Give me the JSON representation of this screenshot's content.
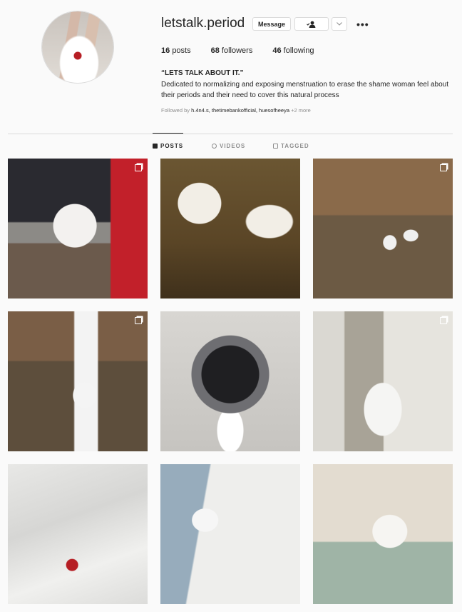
{
  "profile": {
    "username": "letstalk.period",
    "message_label": "Message",
    "follow_icon": "person-check-icon",
    "chevron_icon": "chevron-down-icon",
    "more_icon": "ellipsis-icon",
    "more_text": "•••"
  },
  "stats": {
    "posts_count": "16",
    "posts_label": "posts",
    "followers_count": "68",
    "followers_label": "followers",
    "following_count": "46",
    "following_label": "following"
  },
  "bio": {
    "title": "“LETS TALK ABOUT IT.”",
    "text": "Dedicated to normalizing and exposing menstruation to erase the shame woman feel about their periods and their need to cover this natural process",
    "followed_prefix": "Followed by",
    "followed_names": "h.4n4.s, thetimebankofficial, huesofheeya",
    "followed_more": "+2 more"
  },
  "tabs": [
    {
      "label": "POSTS",
      "icon": "grid-icon",
      "active": true
    },
    {
      "label": "VIDEOS",
      "icon": "play-circle-icon",
      "active": false
    },
    {
      "label": "TAGGED",
      "icon": "tag-icon",
      "active": false
    }
  ],
  "posts": [
    {
      "subject": "dress form with white garment in studio",
      "multi": true
    },
    {
      "subject": "underwear and dress on clothesline",
      "multi": false
    },
    {
      "subject": "people hanging clothes in park",
      "multi": true
    },
    {
      "subject": "stained white dress on clothesline",
      "multi": true
    },
    {
      "subject": "washing machine with stained cloth",
      "multi": false
    },
    {
      "subject": "person in white shorts by door",
      "multi": true
    },
    {
      "subject": "stained white bedsheet",
      "multi": false
    },
    {
      "subject": "folded jeans with underwear",
      "multi": false
    },
    {
      "subject": "person bending in bathroom",
      "multi": false
    }
  ],
  "colors": {
    "background": "#fafafa",
    "text": "#262626",
    "muted": "#8e8e8e",
    "border": "#dbdbdb",
    "stain": "#b61e24"
  }
}
